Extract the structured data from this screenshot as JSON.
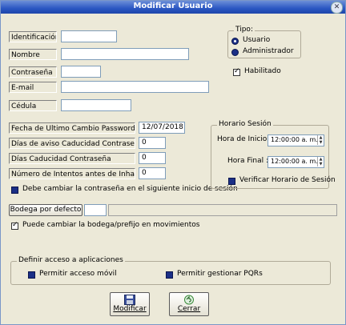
{
  "window": {
    "title": "Modificar Usuario"
  },
  "fields": {
    "identificacion": {
      "label": "Identificación",
      "value": ""
    },
    "nombre": {
      "label": "Nombre",
      "value": ""
    },
    "contrasena": {
      "label": "Contraseña",
      "value": ""
    },
    "email": {
      "label": "E-mail",
      "value": ""
    },
    "cedula": {
      "label": "Cédula",
      "value": ""
    }
  },
  "tipo": {
    "legend": "Tipo:",
    "options": [
      {
        "label": "Usuario",
        "selected": true
      },
      {
        "label": "Administrador",
        "selected": false
      }
    ]
  },
  "habilitado": {
    "label": "Habilitado",
    "checked": true
  },
  "password_policy": {
    "fecha_cambio": {
      "label": "Fecha de Ultimo Cambio Password",
      "value": "12/07/2018"
    },
    "dias_aviso": {
      "label": "Días de aviso Caducidad Contraseña",
      "value": "0"
    },
    "dias_caducidad": {
      "label": "Días Caducidad Contraseña",
      "value": "0"
    },
    "num_intentos": {
      "label": "Número de Intentos antes de Inhabilitar",
      "value": "0"
    },
    "debe_cambiar": {
      "label": "Debe cambiar la contraseña en el siguiente inicio de sesión",
      "checked": false
    }
  },
  "horario": {
    "legend": "Horario Sesión",
    "inicio": {
      "label": "Hora de Inicio :",
      "value": "12:00:00 a. m."
    },
    "final": {
      "label": "Hora Final :",
      "value": "12:00:00 a. m."
    },
    "verificar": {
      "label": "Verificar Horario de Sesión",
      "checked": false
    }
  },
  "bodega": {
    "button": "Bodega por defecto",
    "code": "",
    "name": "",
    "puede_cambiar": {
      "label": "Puede cambiar la bodega/prefijo en movimientos",
      "checked": true
    }
  },
  "acceso": {
    "legend": "Definir acceso a aplicaciones",
    "movil": {
      "label": "Permitir acceso móvil",
      "checked": false
    },
    "pqrs": {
      "label": "Permitir gestionar PQRs",
      "checked": false
    }
  },
  "buttons": {
    "modificar": "Modificar",
    "cerrar": "Cerrar"
  },
  "colors": {
    "title_bar": "#2a56c2",
    "window_bg": "#ece9d8",
    "check_blue": "#1b2f86"
  }
}
